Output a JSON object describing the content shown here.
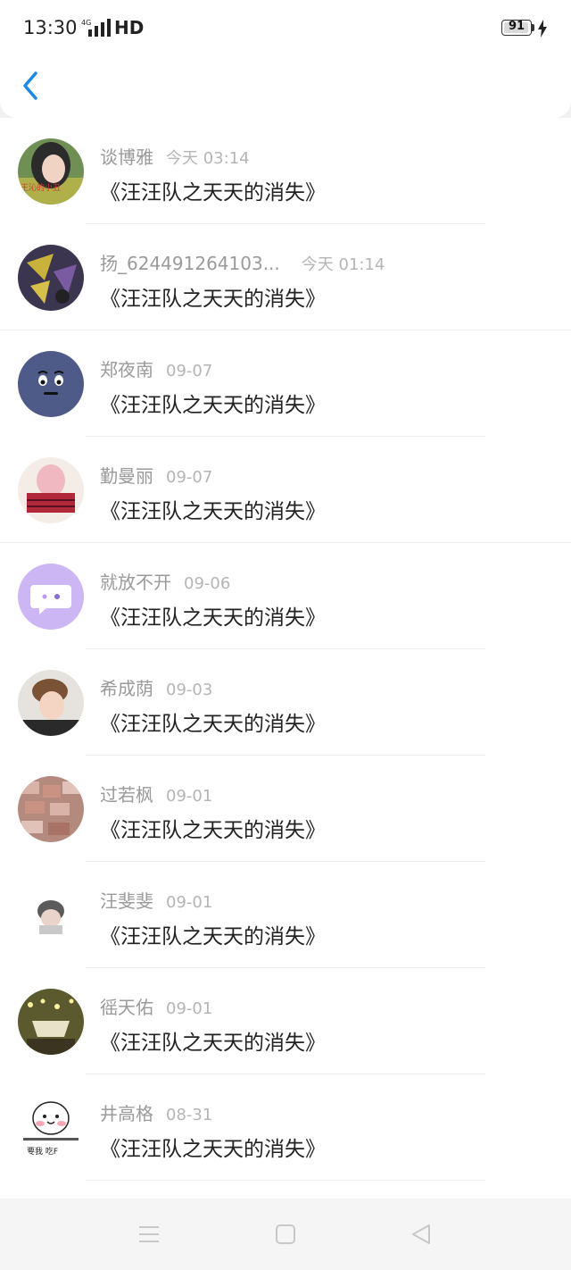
{
  "status_bar": {
    "time": "13:30",
    "network_label": "4G",
    "hd_label": "HD",
    "battery_level": "91"
  },
  "header": {
    "back_icon": "chevron-left-icon"
  },
  "comments": [
    {
      "name": "谈博雅",
      "date": "今天 03:14",
      "title": "《汪汪队之天天的消失》",
      "avatar_text": "王沁的小丑"
    },
    {
      "name": "扬_624491264103...",
      "date": "今天 01:14",
      "title": "《汪汪队之天天的消失》"
    },
    {
      "name": "郑夜南",
      "date": "09-07",
      "title": "《汪汪队之天天的消失》"
    },
    {
      "name": "勤曼丽",
      "date": "09-07",
      "title": "《汪汪队之天天的消失》"
    },
    {
      "name": "就放不开",
      "date": "09-06",
      "title": "《汪汪队之天天的消失》"
    },
    {
      "name": "希成荫",
      "date": "09-03",
      "title": "《汪汪队之天天的消失》"
    },
    {
      "name": "过若枫",
      "date": "09-01",
      "title": "《汪汪队之天天的消失》"
    },
    {
      "name": "汪斐斐",
      "date": "09-01",
      "title": "《汪汪队之天天的消失》"
    },
    {
      "name": "徭天佑",
      "date": "09-01",
      "title": "《汪汪队之天天的消失》"
    },
    {
      "name": "井高格",
      "date": "08-31",
      "title": "《汪汪队之天天的消失》",
      "avatar_text": "要我 吃F"
    }
  ],
  "nav_bar": {
    "menu_icon": "menu-icon",
    "home_icon": "home-square-icon",
    "back_icon": "back-triangle-icon"
  },
  "colors": {
    "accent": "#1e88e5",
    "name": "#9a9a9a",
    "date": "#b5b5b5",
    "title": "#222222"
  }
}
